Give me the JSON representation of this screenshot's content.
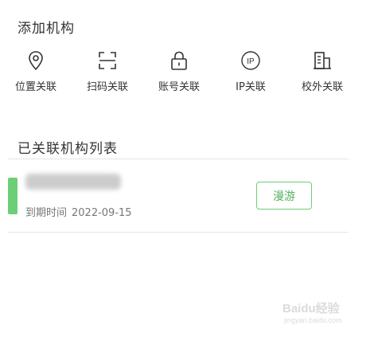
{
  "add_section": {
    "title": "添加机构",
    "methods": [
      {
        "label": "位置关联",
        "icon": "location-pin-icon"
      },
      {
        "label": "扫码关联",
        "icon": "scan-icon"
      },
      {
        "label": "账号关联",
        "icon": "lock-icon"
      },
      {
        "label": "IP关联",
        "icon": "ip-icon",
        "icon_text": "IP"
      },
      {
        "label": "校外关联",
        "icon": "building-icon"
      }
    ]
  },
  "list_section": {
    "title": "已关联机构列表",
    "items": [
      {
        "expire_label": "到期时间",
        "expire_date": "2022-09-15",
        "roam_label": "漫游",
        "accent_color": "#6ccf76"
      }
    ]
  },
  "watermark": {
    "text": "Baidu经验",
    "sub": "jingyan.baidu.com"
  }
}
